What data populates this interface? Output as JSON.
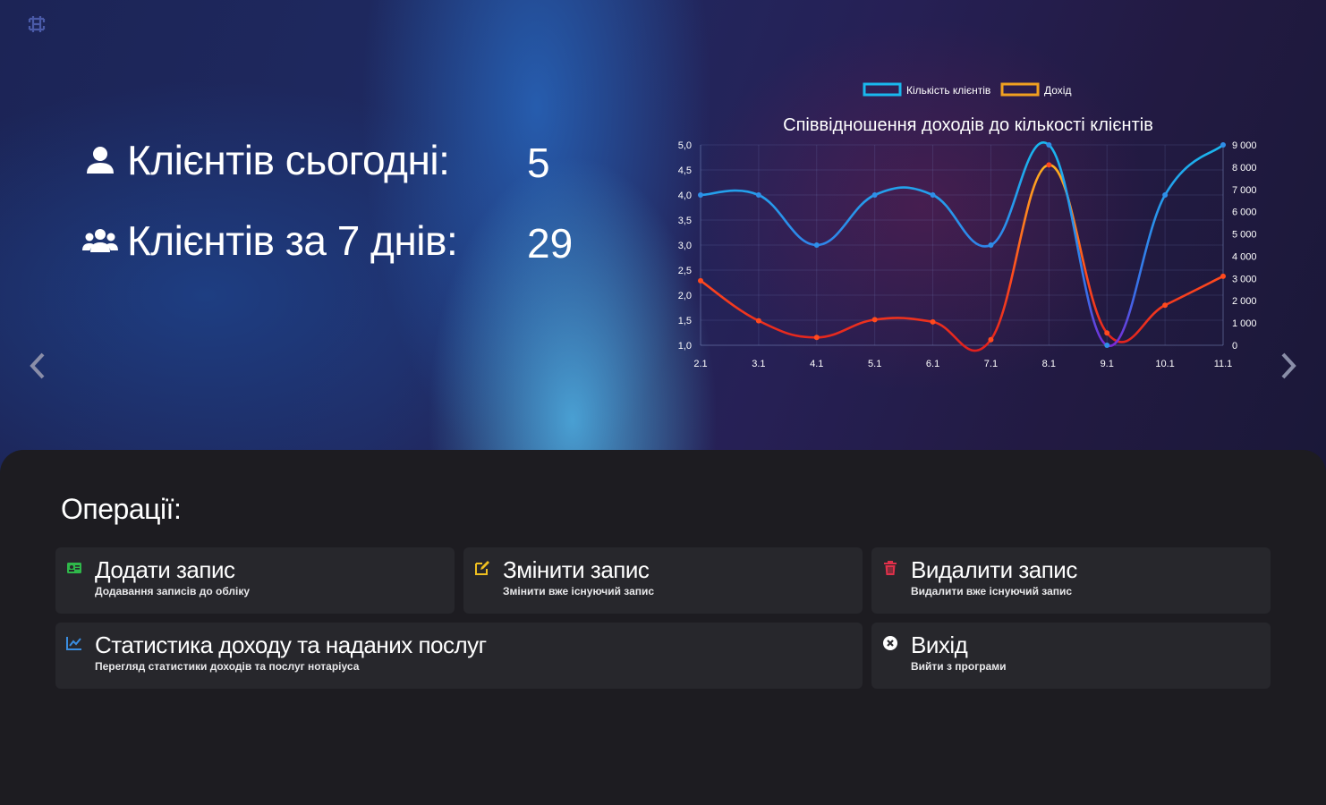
{
  "header": {
    "logo_icon": "network-logo-icon"
  },
  "stats": {
    "today": {
      "icon": "user-icon",
      "label": "Клієнтів сьогодні:",
      "value": "5"
    },
    "week": {
      "icon": "users-icon",
      "label": "Клієнтів за 7 днів:",
      "value": "29"
    }
  },
  "carousel": {
    "prev_icon": "chevron-left-icon",
    "next_icon": "chevron-right-icon"
  },
  "chart_data": {
    "type": "line",
    "title": "Співвідношення доходів до кількості клієнтів",
    "categories": [
      "2.1",
      "3.1",
      "4.1",
      "5.1",
      "6.1",
      "7.1",
      "8.1",
      "9.1",
      "10.1",
      "11.1"
    ],
    "series": [
      {
        "name": "Кількість клієнтів",
        "axis": "left",
        "color": "#2fa8e0",
        "values": [
          4,
          4,
          3,
          4,
          4,
          3,
          5,
          1,
          4,
          5
        ]
      },
      {
        "name": "Дохід",
        "axis": "right",
        "color": "#f0a020",
        "values": [
          2900,
          1100,
          350,
          1150,
          1050,
          250,
          8100,
          550,
          1800,
          3100
        ]
      }
    ],
    "y_left": {
      "range": [
        1,
        5
      ],
      "ticks": [
        "5,0",
        "4,5",
        "4,0",
        "3,5",
        "3,0",
        "2,5",
        "2,0",
        "1,5",
        "1,0"
      ]
    },
    "y_right": {
      "range": [
        0,
        9000
      ],
      "ticks": [
        "9 000",
        "8 000",
        "7 000",
        "6 000",
        "5 000",
        "4 000",
        "3 000",
        "2 000",
        "1 000",
        "0"
      ]
    },
    "grid": true,
    "legend": "top"
  },
  "operations": {
    "title": "Операції:",
    "cards": [
      {
        "icon": "id-card-icon",
        "title": "Додати запис",
        "desc": "Додавання записів до обліку",
        "color": "#2fb84a"
      },
      {
        "icon": "edit-icon",
        "title": "Змінити запис",
        "desc": "Змінити вже існуючий запис",
        "color": "#f0c020"
      },
      {
        "icon": "trash-icon",
        "title": "Видалити запис",
        "desc": "Видалити вже існуючий запис",
        "color": "#e0304a"
      },
      {
        "icon": "chart-line-icon",
        "title": "Статистика доходу та наданих послуг",
        "desc": "Перегляд статистики доходів та послуг нотаріуса",
        "color": "#3a8de0"
      },
      {
        "icon": "close-circle-icon",
        "title": "Вихід",
        "desc": "Вийти з програми",
        "color": "#ffffff"
      }
    ]
  }
}
